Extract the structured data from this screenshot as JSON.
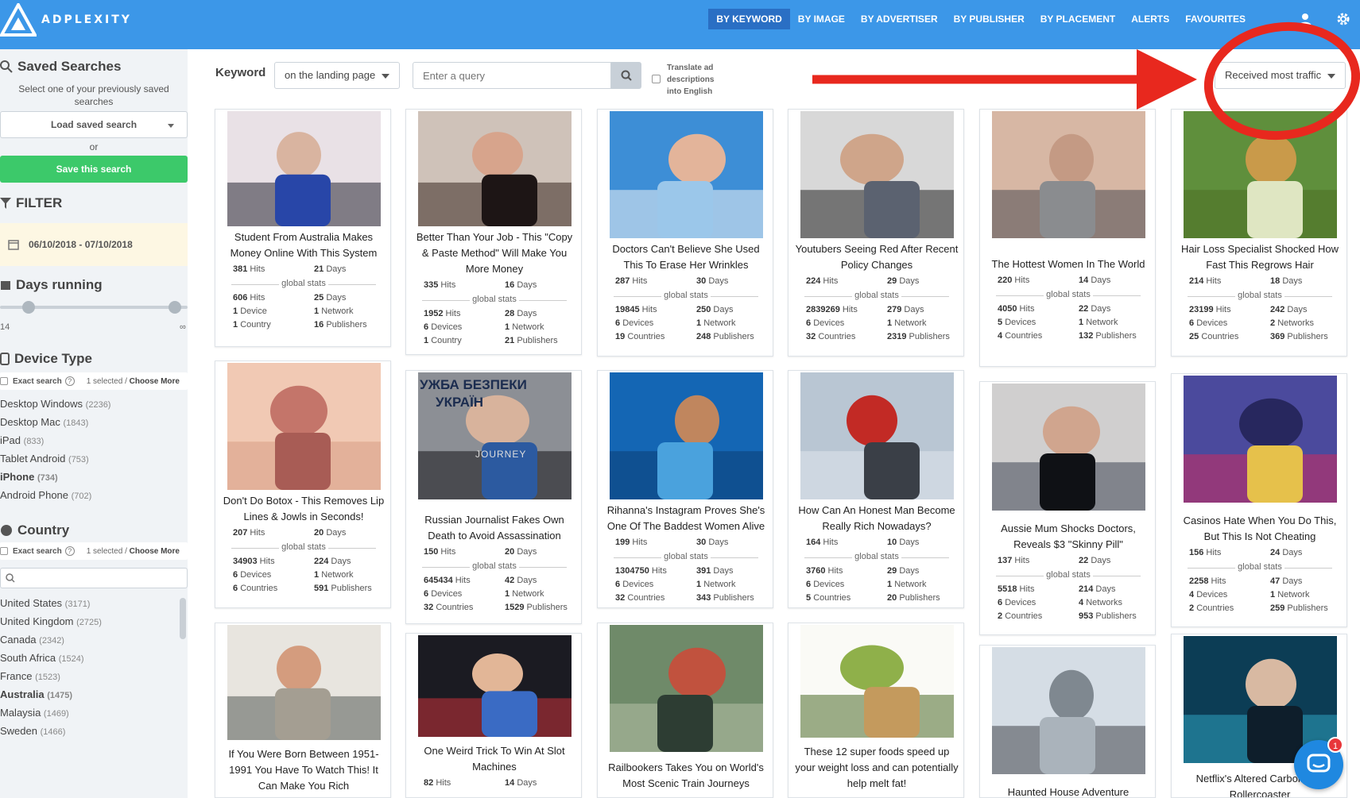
{
  "brand": {
    "name": "ADPLEXITY"
  },
  "nav": {
    "items": [
      {
        "label": "BY KEYWORD"
      },
      {
        "label": "BY IMAGE"
      },
      {
        "label": "BY ADVERTISER"
      },
      {
        "label": "BY PUBLISHER"
      },
      {
        "label": "BY PLACEMENT"
      },
      {
        "label": "ALERTS"
      },
      {
        "label": "FAVOURITES"
      }
    ],
    "icons": [
      "user-icon",
      "gear-icon"
    ]
  },
  "sidebar": {
    "saved_searches": {
      "title": "Saved Searches",
      "description": "Select one of your previously saved searches",
      "load_label": "Load saved search",
      "or_label": "or",
      "save_label": "Save this search"
    },
    "filter": {
      "title": "FILTER",
      "date_range": "06/10/2018 - 07/10/2018"
    },
    "days_running": {
      "title": "Days running",
      "min_label": "14",
      "max_label": "∞"
    },
    "device_type": {
      "title": "Device Type",
      "exact_label": "Exact search",
      "selected_text": "1 selected /",
      "choose_more": "Choose More",
      "items": [
        {
          "name": "Desktop Windows",
          "count": "(2236)",
          "bold": false
        },
        {
          "name": "Desktop Mac",
          "count": "(1843)",
          "bold": false
        },
        {
          "name": "iPad",
          "count": "(833)",
          "bold": false
        },
        {
          "name": "Tablet Android",
          "count": "(753)",
          "bold": false
        },
        {
          "name": "iPhone",
          "count": "(734)",
          "bold": true
        },
        {
          "name": "Android Phone",
          "count": "(702)",
          "bold": false
        }
      ]
    },
    "country": {
      "title": "Country",
      "exact_label": "Exact search",
      "selected_text": "1 selected /",
      "choose_more": "Choose More",
      "items": [
        {
          "name": "United States",
          "count": "(3171)",
          "bold": false
        },
        {
          "name": "United Kingdom",
          "count": "(2725)",
          "bold": false
        },
        {
          "name": "Canada",
          "count": "(2342)",
          "bold": false
        },
        {
          "name": "South Africa",
          "count": "(1524)",
          "bold": false
        },
        {
          "name": "France",
          "count": "(1523)",
          "bold": false
        },
        {
          "name": "Australia",
          "count": "(1475)",
          "bold": true
        },
        {
          "name": "Malaysia",
          "count": "(1469)",
          "bold": false
        },
        {
          "name": "Sweden",
          "count": "(1466)",
          "bold": false
        }
      ]
    }
  },
  "search": {
    "label": "Keyword",
    "scope": "on the landing page",
    "placeholder": "Enter a query",
    "translate_label": "Translate ad descriptions into English",
    "sort": "Received most traffic"
  },
  "colors": {
    "nav_bg": "#3c97e8",
    "nav_active": "#2a6fc4",
    "save_green": "#3cc96a",
    "annotation_red": "#e8281e"
  },
  "cards": [
    {
      "title": "Student From Australia Makes Money Online With This System",
      "hits": "381",
      "days": "21",
      "g_hits": "606",
      "g_days": "25",
      "devices": "1",
      "devices_label": "Device",
      "networks": "1",
      "networks_label": "Network",
      "countries": "1",
      "countries_label": "Country",
      "publishers": "16"
    },
    {
      "title": "Better Than Your Job - This \"Copy & Paste Method\" Will Make You More Money",
      "hits": "335",
      "days": "16",
      "g_hits": "1952",
      "g_days": "28",
      "devices": "6",
      "devices_label": "Devices",
      "networks": "1",
      "networks_label": "Network",
      "countries": "1",
      "countries_label": "Country",
      "publishers": "21"
    },
    {
      "title": "Doctors Can't Believe She Used This To Erase Her Wrinkles",
      "hits": "287",
      "days": "30",
      "g_hits": "19845",
      "g_days": "250",
      "devices": "6",
      "devices_label": "Devices",
      "networks": "1",
      "networks_label": "Network",
      "countries": "19",
      "countries_label": "Countries",
      "publishers": "248"
    },
    {
      "title": "Youtubers Seeing Red After Recent Policy Changes",
      "hits": "224",
      "days": "29",
      "g_hits": "2839269",
      "g_days": "279",
      "devices": "6",
      "devices_label": "Devices",
      "networks": "1",
      "networks_label": "Network",
      "countries": "32",
      "countries_label": "Countries",
      "publishers": "2319"
    },
    {
      "title": "The Hottest Women In The World",
      "hits": "220",
      "days": "14",
      "g_hits": "4050",
      "g_days": "22",
      "devices": "5",
      "devices_label": "Devices",
      "networks": "1",
      "networks_label": "Network",
      "countries": "4",
      "countries_label": "Countries",
      "publishers": "132"
    },
    {
      "title": "Hair Loss Specialist Shocked How Fast This Regrows Hair",
      "hits": "214",
      "days": "18",
      "g_hits": "23199",
      "g_days": "242",
      "devices": "6",
      "devices_label": "Devices",
      "networks": "2",
      "networks_label": "Networks",
      "countries": "25",
      "countries_label": "Countries",
      "publishers": "369"
    },
    {
      "title": "Don't Do Botox - This Removes Lip Lines & Jowls in Seconds!",
      "hits": "207",
      "days": "20",
      "g_hits": "34903",
      "g_days": "224",
      "devices": "6",
      "devices_label": "Devices",
      "networks": "1",
      "networks_label": "Network",
      "countries": "6",
      "countries_label": "Countries",
      "publishers": "591"
    },
    {
      "title": "Russian Journalist Fakes Own Death to Avoid Assassination",
      "hits": "150",
      "days": "20",
      "g_hits": "645434",
      "g_days": "42",
      "devices": "6",
      "devices_label": "Devices",
      "networks": "1",
      "networks_label": "Network",
      "countries": "32",
      "countries_label": "Countries",
      "publishers": "1529",
      "img_text_1": "УЖБА БЕЗПЕКИ",
      "img_text_2": "УКРАЇН",
      "img_text_3": "JOURNEY"
    },
    {
      "title": "Rihanna's Instagram Proves She's One Of The Baddest Women Alive",
      "hits": "199",
      "days": "30",
      "g_hits": "1304750",
      "g_days": "391",
      "devices": "6",
      "devices_label": "Devices",
      "networks": "1",
      "networks_label": "Network",
      "countries": "32",
      "countries_label": "Countries",
      "publishers": "343"
    },
    {
      "title": "How Can An Honest Man Become Really Rich Nowadays?",
      "hits": "164",
      "days": "10",
      "g_hits": "3760",
      "g_days": "29",
      "devices": "6",
      "devices_label": "Devices",
      "networks": "1",
      "networks_label": "Network",
      "countries": "5",
      "countries_label": "Countries",
      "publishers": "20"
    },
    {
      "title": "Aussie Mum Shocks Doctors, Reveals $3 \"Skinny Pill\"",
      "hits": "137",
      "days": "22",
      "g_hits": "5518",
      "g_days": "214",
      "devices": "6",
      "devices_label": "Devices",
      "networks": "4",
      "networks_label": "Networks",
      "countries": "2",
      "countries_label": "Countries",
      "publishers": "953"
    },
    {
      "title": "Casinos Hate When You Do This, But This Is Not Cheating",
      "hits": "156",
      "days": "24",
      "g_hits": "2258",
      "g_days": "47",
      "devices": "4",
      "devices_label": "Devices",
      "networks": "1",
      "networks_label": "Network",
      "countries": "2",
      "countries_label": "Countries",
      "publishers": "259"
    },
    {
      "title": "If You Were Born Between 1951-1991 You Have To Watch This! It Can Make You Rich"
    },
    {
      "title": "One Weird Trick To Win At Slot Machines",
      "hits": "82",
      "days": "14"
    },
    {
      "title": "Railbookers Takes You on World's Most Scenic Train Journeys"
    },
    {
      "title": "These 12 super foods speed up your weight loss and can potentially help melt fat!"
    },
    {
      "title": "Haunted House Adventure"
    },
    {
      "title": "Netflix's Altered Carbon Is A Rollercoaster"
    }
  ],
  "labels": {
    "hits": "Hits",
    "days": "Days",
    "global_stats": "global stats",
    "publishers": "Publishers"
  },
  "chat": {
    "badge": "1"
  }
}
